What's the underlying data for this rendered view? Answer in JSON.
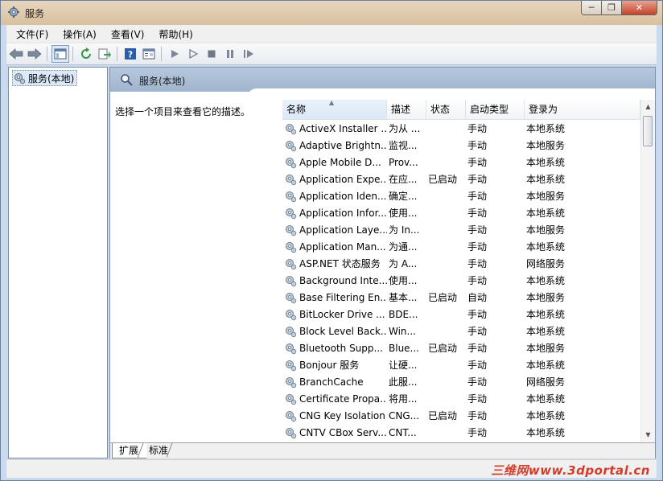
{
  "window": {
    "title": "服务"
  },
  "menu": [
    "文件(F)",
    "操作(A)",
    "查看(V)",
    "帮助(H)"
  ],
  "tree": {
    "root_label": "服务(本地)"
  },
  "main": {
    "header_title": "服务(本地)",
    "description_hint": "选择一个项目来查看它的描述。"
  },
  "table": {
    "columns": [
      "名称",
      "描述",
      "状态",
      "启动类型",
      "登录为"
    ],
    "rows": [
      {
        "name": "ActiveX Installer ...",
        "desc": "为从 ...",
        "status": "",
        "startup": "手动",
        "logon": "本地系统"
      },
      {
        "name": "Adaptive Brightn...",
        "desc": "监视...",
        "status": "",
        "startup": "手动",
        "logon": "本地服务"
      },
      {
        "name": "Apple Mobile D...",
        "desc": "Prov...",
        "status": "",
        "startup": "手动",
        "logon": "本地系统"
      },
      {
        "name": "Application Expe...",
        "desc": "在应...",
        "status": "已启动",
        "startup": "手动",
        "logon": "本地系统"
      },
      {
        "name": "Application Iden...",
        "desc": "确定...",
        "status": "",
        "startup": "手动",
        "logon": "本地服务"
      },
      {
        "name": "Application Infor...",
        "desc": "使用...",
        "status": "",
        "startup": "手动",
        "logon": "本地系统"
      },
      {
        "name": "Application Laye...",
        "desc": "为 In...",
        "status": "",
        "startup": "手动",
        "logon": "本地服务"
      },
      {
        "name": "Application Man...",
        "desc": "为通...",
        "status": "",
        "startup": "手动",
        "logon": "本地系统"
      },
      {
        "name": "ASP.NET 状态服务",
        "desc": "为 A...",
        "status": "",
        "startup": "手动",
        "logon": "网络服务"
      },
      {
        "name": "Background Inte...",
        "desc": "使用...",
        "status": "",
        "startup": "手动",
        "logon": "本地系统"
      },
      {
        "name": "Base Filtering En...",
        "desc": "基本...",
        "status": "已启动",
        "startup": "自动",
        "logon": "本地服务"
      },
      {
        "name": "BitLocker Drive ...",
        "desc": "BDE...",
        "status": "",
        "startup": "手动",
        "logon": "本地系统"
      },
      {
        "name": "Block Level Back...",
        "desc": "Win...",
        "status": "",
        "startup": "手动",
        "logon": "本地系统"
      },
      {
        "name": "Bluetooth Supp...",
        "desc": "Blue...",
        "status": "已启动",
        "startup": "手动",
        "logon": "本地服务"
      },
      {
        "name": "Bonjour 服务",
        "desc": "让硬...",
        "status": "",
        "startup": "手动",
        "logon": "本地系统"
      },
      {
        "name": "BranchCache",
        "desc": "此服...",
        "status": "",
        "startup": "手动",
        "logon": "网络服务"
      },
      {
        "name": "Certificate Propa...",
        "desc": "将用...",
        "status": "",
        "startup": "手动",
        "logon": "本地系统"
      },
      {
        "name": "CNG Key Isolation",
        "desc": "CNG...",
        "status": "已启动",
        "startup": "手动",
        "logon": "本地系统"
      },
      {
        "name": "CNTV CBox Serv...",
        "desc": "CNT...",
        "status": "",
        "startup": "手动",
        "logon": "本地系统"
      }
    ]
  },
  "tabs": [
    "扩展",
    "标准"
  ],
  "watermark": "三维网www.3dportal.cn",
  "icons": {
    "service": "gear-icon",
    "window": "services-icon"
  },
  "colors": {
    "title_bar": "#d8c09f",
    "header_band": "#9fb4cd",
    "close_button": "#c4432c",
    "watermark": "#d63b2a"
  }
}
